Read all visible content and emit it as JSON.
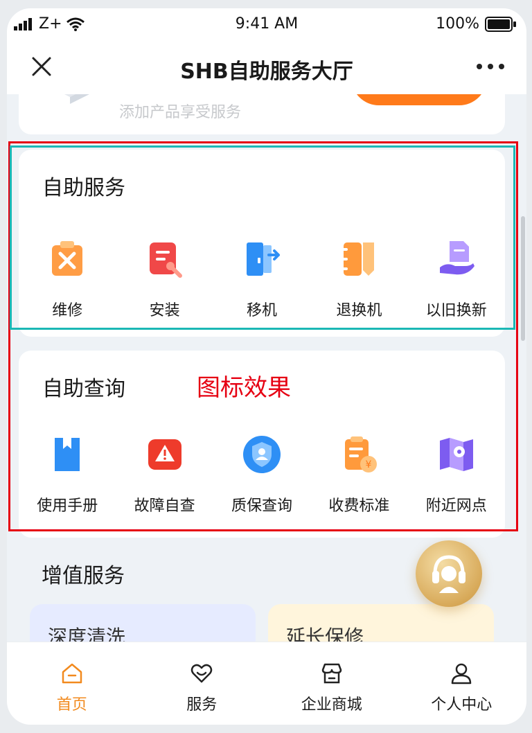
{
  "status_bar": {
    "carrier": "Z+",
    "time": "9:41 AM",
    "battery": "100%"
  },
  "nav": {
    "title": "SHB自助服务大厅"
  },
  "top_card": {
    "hint": "添加产品享受服务"
  },
  "self_service": {
    "title": "自助服务",
    "items": [
      {
        "label": "维修",
        "icon": "repair-clipboard-icon"
      },
      {
        "label": "安装",
        "icon": "install-form-icon"
      },
      {
        "label": "移机",
        "icon": "move-door-icon"
      },
      {
        "label": "退换机",
        "icon": "exchange-notebook-icon"
      },
      {
        "label": "以旧换新",
        "icon": "trade-in-hand-icon"
      }
    ]
  },
  "self_query": {
    "title": "自助查询",
    "items": [
      {
        "label": "使用手册",
        "icon": "manual-book-icon"
      },
      {
        "label": "故障自查",
        "icon": "fault-warning-icon"
      },
      {
        "label": "质保查询",
        "icon": "warranty-shield-icon"
      },
      {
        "label": "收费标准",
        "icon": "fee-receipt-icon"
      },
      {
        "label": "附近网点",
        "icon": "nearby-map-icon"
      }
    ]
  },
  "annotation": {
    "text": "图标效果"
  },
  "value_added": {
    "title": "增值服务",
    "cards": [
      "深度清洗",
      "延长保修"
    ]
  },
  "tabs": [
    {
      "label": "首页",
      "icon": "home-icon",
      "active": true
    },
    {
      "label": "服务",
      "icon": "heart-icon",
      "active": false
    },
    {
      "label": "企业商城",
      "icon": "store-icon",
      "active": false
    },
    {
      "label": "个人中心",
      "icon": "person-icon",
      "active": false
    }
  ],
  "colors": {
    "accent": "#f28a1e",
    "annotation_red": "#e60012",
    "annotation_teal": "#1bb7b5"
  }
}
